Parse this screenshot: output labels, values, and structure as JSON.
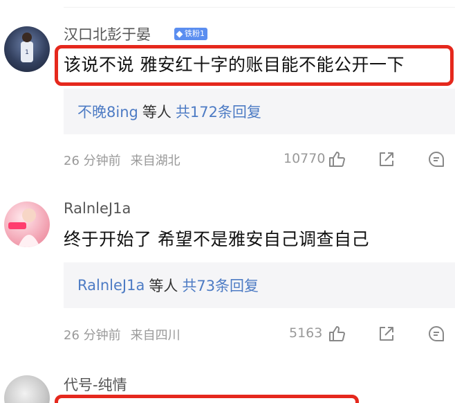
{
  "comments": [
    {
      "username": "汉口北彭于晏",
      "badge": "铁粉1",
      "text": "该说不说 雅安红十字的账目能不能公开一下",
      "reply_user": "不晚8ing",
      "reply_mid": "等人",
      "reply_count": "共172条回复",
      "time": "26 分钟前",
      "location": "来自湖北",
      "likes": "10770"
    },
    {
      "username": "RalnleJ1a",
      "text": "终于开始了 希望不是雅安自己调查自己",
      "reply_user": "RalnleJ1a",
      "reply_mid": "等人",
      "reply_count": "共73条回复",
      "time": "26 分钟前",
      "location": "来自四川",
      "likes": "5163"
    },
    {
      "username": "代号-纯情"
    }
  ],
  "icons": [
    "thumbs-up-icon",
    "share-icon",
    "comment-icon"
  ],
  "colors": {
    "highlight": "#e5281d",
    "link": "#4d7bc4",
    "badge": "#5b8ef0"
  }
}
